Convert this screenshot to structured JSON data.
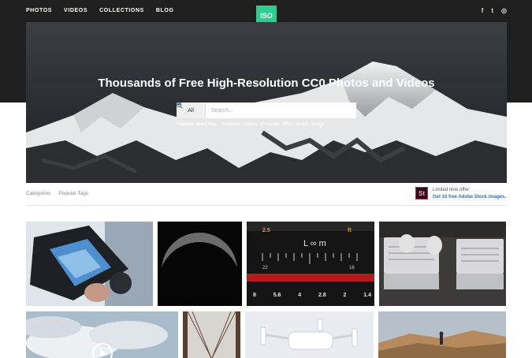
{
  "nav": {
    "items": [
      "PHOTOS",
      "VIDEOS",
      "COLLECTIONS",
      "BLOG"
    ]
  },
  "logo": {
    "text": "ISO",
    "color": "#2ecc8f"
  },
  "social": {
    "icons": [
      "facebook-icon",
      "twitter-icon",
      "instagram-icon"
    ],
    "glyphs": [
      "f",
      "t",
      "◎"
    ]
  },
  "hero": {
    "title": "Thousands of Free High-Resolution CC0 Photos and Videos",
    "search": {
      "category": "All",
      "placeholder": "Search..."
    },
    "popular_label": "Popular searches:",
    "popular_terms": "business, nature, computer, office, beach, design"
  },
  "subnav": {
    "categories": "Categories",
    "popular_tags": "Popular Tags"
  },
  "offer": {
    "icon_text": "St",
    "line1": "Limited time offer:",
    "line2": "Get 10 free Adobe Stock images."
  },
  "lens_scale": {
    "top": [
      "2.5",
      "ft"
    ],
    "infinity": "L ∞ m",
    "bottom": [
      "8",
      "5.6",
      "4",
      "2.8",
      "2",
      "1.4"
    ],
    "side": [
      "22",
      "16"
    ]
  },
  "colors": {
    "accent": "#2ecc8f",
    "link": "#2a6fb0",
    "dark_bar": "#1f1f1f"
  }
}
